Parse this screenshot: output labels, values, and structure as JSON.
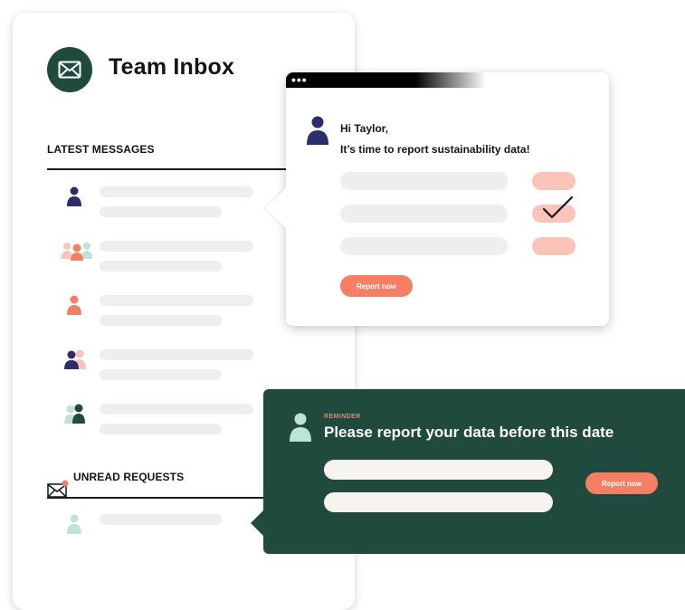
{
  "inbox": {
    "title": "Team Inbox",
    "logo_icon": "envelope-icon",
    "latest_section": "LATEST MESSAGES",
    "unread_section": "UNREAD REQUESTS",
    "unread_icon": "envelope-notification-icon",
    "message_rows": [
      {
        "avatar": "single-person-icon",
        "color": "#2b2e6b"
      },
      {
        "avatar": "group-people-icon",
        "color": "#f57f65"
      },
      {
        "avatar": "single-person-icon",
        "color": "#f57f65"
      },
      {
        "avatar": "two-people-icon",
        "color": "#2b2e6b"
      },
      {
        "avatar": "two-people-icon",
        "color": "#1f4a3d"
      }
    ],
    "unread_rows": [
      {
        "avatar": "single-person-icon",
        "color": "#bfe3d6"
      }
    ]
  },
  "popup": {
    "window_dots": "•••",
    "greeting": "Hi Taylor,",
    "message": "It’s time to report sustainability data!",
    "checked_index": 1,
    "check_icon": "checkmark-icon",
    "button_label": "Report now"
  },
  "reminder": {
    "kicker": "REMINDER",
    "title": "Please report your data before this date",
    "button_label": "Report now"
  },
  "colors": {
    "dark_green": "#1f4a3d",
    "coral": "#f57f65",
    "light_coral": "#fbc4b9",
    "navy": "#2b2e6b",
    "placeholder_grey": "#eeeeee"
  }
}
